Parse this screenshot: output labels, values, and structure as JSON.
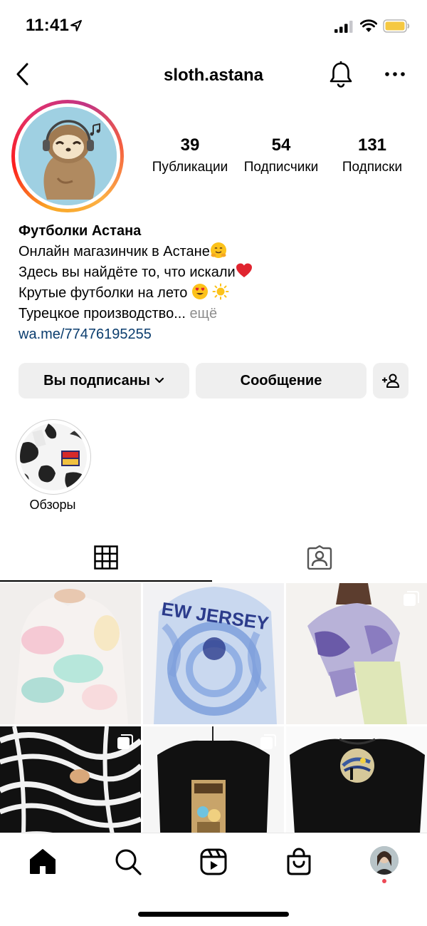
{
  "status": {
    "time": "11:41"
  },
  "header": {
    "username": "sloth.astana"
  },
  "stats": [
    {
      "num": "39",
      "label": "Публикации"
    },
    {
      "num": "54",
      "label": "Подписчики"
    },
    {
      "num": "131",
      "label": "Подписки"
    }
  ],
  "bio": {
    "name": "Футболки Астана",
    "line1": "Онлайн магазинчик в Астане",
    "line2": "Здесь вы найдёте то, что искали",
    "line3": "Крутые футболки на лето",
    "line4": "Турецкое производство...",
    "more": "ещё",
    "link": "wa.me/77476195255"
  },
  "buttons": {
    "following": "Вы подписаны",
    "message": "Сообщение"
  },
  "highlights": [
    {
      "label": "Обзоры"
    }
  ],
  "icons": {
    "back": "chevron-left-icon",
    "bell": "bell-icon",
    "more": "more-horizontal-icon",
    "grid": "grid-icon",
    "tagged": "tagged-person-icon",
    "home": "home-icon",
    "search": "search-icon",
    "reels": "reels-icon",
    "shop": "shop-bag-icon"
  },
  "colors": {
    "link": "#0b3d6e",
    "secondary": "#8e8e8e",
    "button_bg": "#efefef",
    "notification_dot": "#ed4956"
  }
}
